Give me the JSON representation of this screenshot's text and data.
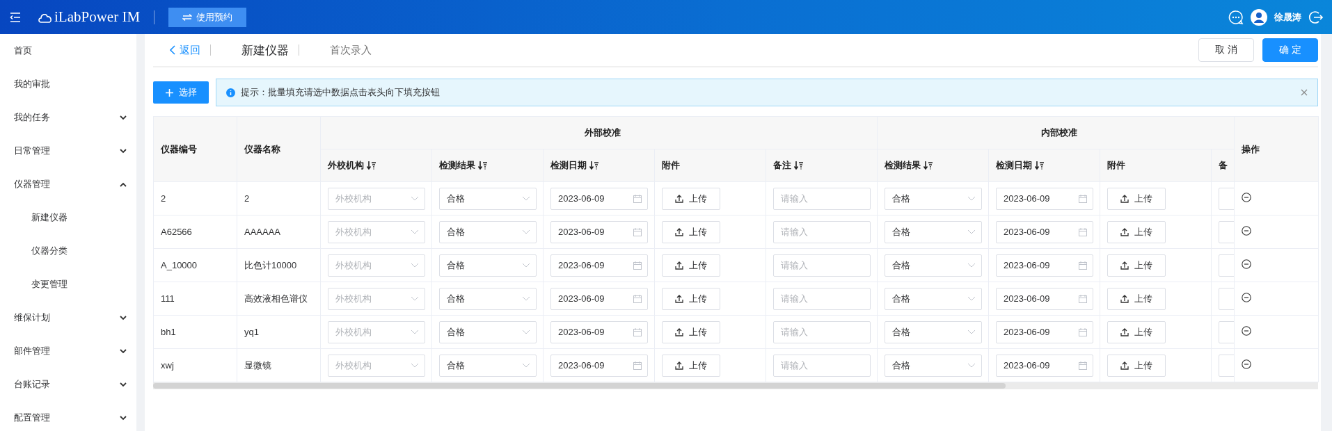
{
  "topbar": {
    "logo": "iLabPower IM",
    "booking_button": "使用预约",
    "user_name": "徐晟涛"
  },
  "sidebar": {
    "items": [
      {
        "label": "首页",
        "selected": false
      },
      {
        "label": "我的审批",
        "selected": false
      },
      {
        "label": "我的任务",
        "selected": false,
        "expanded": false
      },
      {
        "label": "日常管理",
        "selected": false,
        "expanded": false
      },
      {
        "label": "仪器管理",
        "selected": false,
        "expanded": true,
        "children": [
          {
            "label": "新建仪器",
            "selected": false
          },
          {
            "label": "仪器分类",
            "selected": false
          },
          {
            "label": "变更管理",
            "selected": false
          }
        ]
      },
      {
        "label": "维保计划",
        "selected": false,
        "expanded": false
      },
      {
        "label": "部件管理",
        "selected": false,
        "expanded": false
      },
      {
        "label": "台账记录",
        "selected": false,
        "expanded": false
      },
      {
        "label": "配置管理",
        "selected": false,
        "expanded": false
      }
    ]
  },
  "header": {
    "back": "返回",
    "title": "新建仪器",
    "step": "首次录入",
    "cancel": "取 消",
    "confirm": "确 定"
  },
  "toolbar": {
    "select_button": "选择"
  },
  "tip": {
    "text": "提示：批量填充请选中数据点击表头向下填充按钮"
  },
  "table": {
    "fixed_columns": [
      "仪器编号",
      "仪器名称"
    ],
    "groups": [
      {
        "title": "外部校准",
        "columns": [
          {
            "label": "外校机构",
            "sortable": true
          },
          {
            "label": "检测结果",
            "sortable": true
          },
          {
            "label": "检测日期",
            "sortable": true
          },
          {
            "label": "附件",
            "sortable": false
          },
          {
            "label": "备注",
            "sortable": true
          }
        ]
      },
      {
        "title": "内部校准",
        "columns": [
          {
            "label": "检测结果",
            "sortable": true
          },
          {
            "label": "检测日期",
            "sortable": true
          },
          {
            "label": "附件",
            "sortable": false
          },
          {
            "label": "备",
            "sortable": false
          }
        ]
      }
    ],
    "action_column": "操作",
    "rows": [
      {
        "id": "2",
        "name": "2",
        "cells": [
          {
            "kind": "select",
            "placeholder": "外校机构"
          },
          {
            "kind": "select",
            "value": "合格"
          },
          {
            "kind": "date",
            "value": "2023-06-09"
          },
          {
            "kind": "upload",
            "label": "上传"
          },
          {
            "kind": "input",
            "placeholder": "请输入"
          },
          {
            "kind": "select",
            "value": "合格"
          },
          {
            "kind": "date",
            "value": "2023-06-09"
          },
          {
            "kind": "upload",
            "label": "上传"
          },
          {
            "kind": "stub"
          }
        ]
      },
      {
        "id": "A62566",
        "name": "AAAAAA",
        "cells": [
          {
            "kind": "select",
            "placeholder": "外校机构"
          },
          {
            "kind": "select",
            "value": "合格"
          },
          {
            "kind": "date",
            "value": "2023-06-09"
          },
          {
            "kind": "upload",
            "label": "上传"
          },
          {
            "kind": "input",
            "placeholder": "请输入"
          },
          {
            "kind": "select",
            "value": "合格"
          },
          {
            "kind": "date",
            "value": "2023-06-09"
          },
          {
            "kind": "upload",
            "label": "上传"
          },
          {
            "kind": "stub"
          }
        ]
      },
      {
        "id": "A_10000",
        "name": "比色计10000",
        "cells": [
          {
            "kind": "select",
            "placeholder": "外校机构"
          },
          {
            "kind": "select",
            "value": "合格"
          },
          {
            "kind": "date",
            "value": "2023-06-09"
          },
          {
            "kind": "upload",
            "label": "上传"
          },
          {
            "kind": "input",
            "placeholder": "请输入"
          },
          {
            "kind": "select",
            "value": "合格"
          },
          {
            "kind": "date",
            "value": "2023-06-09"
          },
          {
            "kind": "upload",
            "label": "上传"
          },
          {
            "kind": "stub"
          }
        ]
      },
      {
        "id": "111",
        "name": "高效液相色谱仪",
        "cells": [
          {
            "kind": "select",
            "placeholder": "外校机构"
          },
          {
            "kind": "select",
            "value": "合格"
          },
          {
            "kind": "date",
            "value": "2023-06-09"
          },
          {
            "kind": "upload",
            "label": "上传"
          },
          {
            "kind": "input",
            "placeholder": "请输入"
          },
          {
            "kind": "select",
            "value": "合格"
          },
          {
            "kind": "date",
            "value": "2023-06-09"
          },
          {
            "kind": "upload",
            "label": "上传"
          },
          {
            "kind": "stub"
          }
        ]
      },
      {
        "id": "bh1",
        "name": "yq1",
        "cells": [
          {
            "kind": "select",
            "placeholder": "外校机构"
          },
          {
            "kind": "select",
            "value": "合格"
          },
          {
            "kind": "date",
            "value": "2023-06-09"
          },
          {
            "kind": "upload",
            "label": "上传"
          },
          {
            "kind": "input",
            "placeholder": "请输入"
          },
          {
            "kind": "select",
            "value": "合格"
          },
          {
            "kind": "date",
            "value": "2023-06-09"
          },
          {
            "kind": "upload",
            "label": "上传"
          },
          {
            "kind": "stub"
          }
        ]
      },
      {
        "id": "xwj",
        "name": "显微镜",
        "cells": [
          {
            "kind": "select",
            "placeholder": "外校机构"
          },
          {
            "kind": "select",
            "value": "合格"
          },
          {
            "kind": "date",
            "value": "2023-06-09"
          },
          {
            "kind": "upload",
            "label": "上传"
          },
          {
            "kind": "input",
            "placeholder": "请输入"
          },
          {
            "kind": "select",
            "value": "合格"
          },
          {
            "kind": "date",
            "value": "2023-06-09"
          },
          {
            "kind": "upload",
            "label": "上传"
          },
          {
            "kind": "stub"
          }
        ]
      }
    ]
  }
}
